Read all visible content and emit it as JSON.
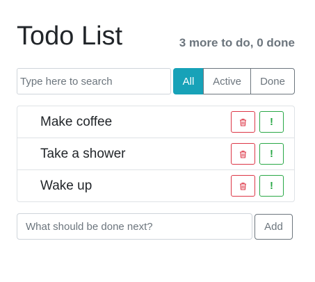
{
  "header": {
    "title": "Todo List",
    "summary": "3 more to do, 0 done"
  },
  "search": {
    "placeholder": "Type here to search",
    "value": ""
  },
  "filters": {
    "all": "All",
    "active": "Active",
    "done": "Done",
    "selected": "All"
  },
  "todos": [
    {
      "label": "Make coffee",
      "delete_icon": "trash-icon",
      "important_icon": "exclamation-icon"
    },
    {
      "label": "Take a shower",
      "delete_icon": "trash-icon",
      "important_icon": "exclamation-icon"
    },
    {
      "label": "Wake up",
      "delete_icon": "trash-icon",
      "important_icon": "exclamation-icon"
    }
  ],
  "add_form": {
    "placeholder": "What should be done next?",
    "value": "",
    "button_label": "Add"
  },
  "icons": {
    "important_glyph": "!"
  },
  "colors": {
    "accent": "#17a2b8",
    "danger": "#dc3545",
    "success": "#28a745",
    "muted": "#6c757d"
  }
}
